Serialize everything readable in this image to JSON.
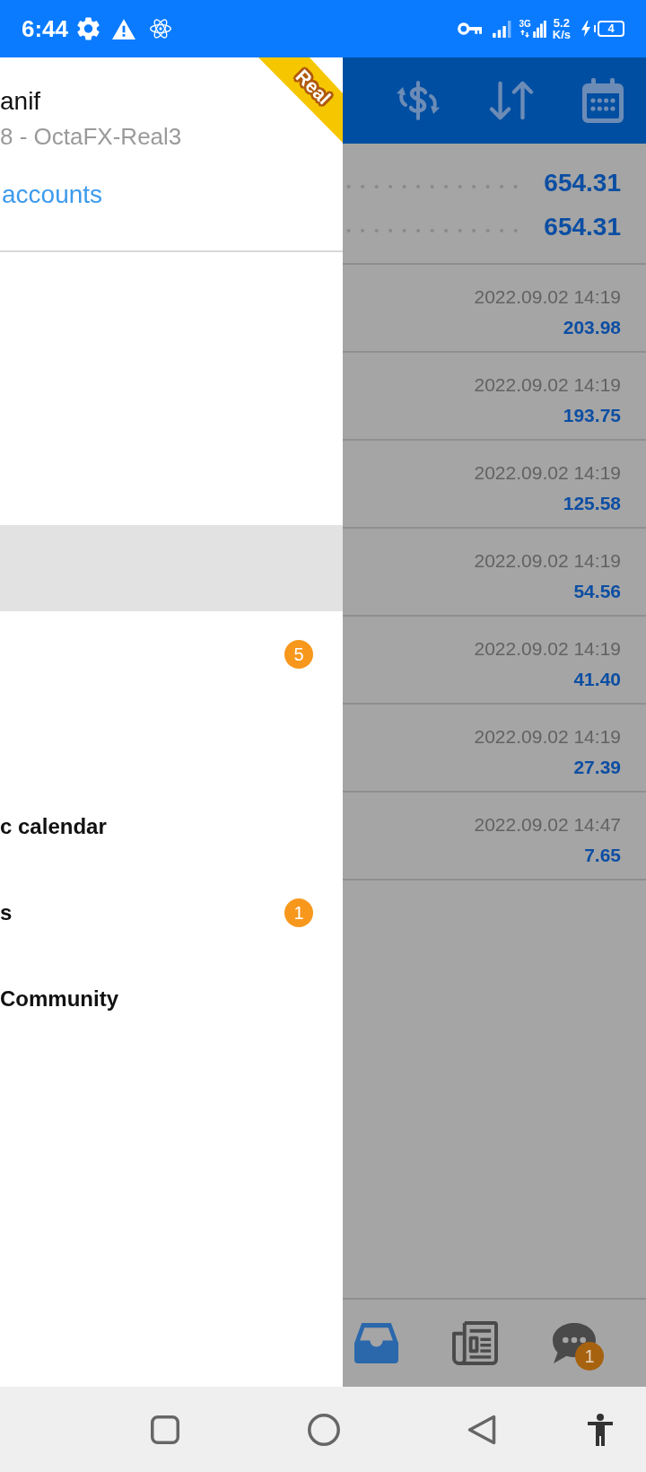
{
  "status_bar": {
    "time": "6:44",
    "network_type": "3G",
    "speed": "5.2",
    "speed_unit": "K/s",
    "charging": true,
    "battery": "4"
  },
  "drawer": {
    "account": {
      "name": "anif",
      "server": "8 - OctaFX-Real3",
      "ribbon": "Real",
      "link": "accounts"
    },
    "items": [
      {
        "selected": false
      },
      {
        "selected": false
      },
      {
        "selected": false
      },
      {
        "selected": true
      },
      {
        "badge": "5",
        "selected": false
      },
      {
        "selected": false
      },
      {
        "label": "c calendar",
        "selected": false
      },
      {
        "label": "s",
        "badge": "1",
        "selected": false
      },
      {
        "label": "Community",
        "selected": false
      }
    ]
  },
  "history": {
    "summary": [
      {
        "value": "654.31"
      },
      {
        "value": "654.31"
      }
    ],
    "deals": [
      {
        "time": "2022.09.02 14:19",
        "amount": "203.98"
      },
      {
        "time": "2022.09.02 14:19",
        "amount": "193.75"
      },
      {
        "time": "2022.09.02 14:19",
        "amount": "125.58"
      },
      {
        "time": "2022.09.02 14:19",
        "amount": "54.56"
      },
      {
        "time": "2022.09.02 14:19",
        "amount": "41.40"
      },
      {
        "time": "2022.09.02 14:19",
        "amount": "27.39"
      },
      {
        "time": "2022.09.02 14:47",
        "amount": "7.65"
      }
    ],
    "tabs": [
      {
        "kind": "inbox",
        "selected": true
      },
      {
        "kind": "news",
        "selected": false
      },
      {
        "kind": "chat",
        "selected": false,
        "badge": "1"
      }
    ]
  }
}
